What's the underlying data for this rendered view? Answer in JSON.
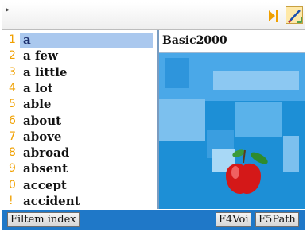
{
  "search": {
    "cursor_mark": "▸",
    "value": ""
  },
  "toolbar": {
    "speaker_icon": "speaker-play-icon",
    "pen_icon": "pen-edit-icon"
  },
  "words": [
    {
      "num": "1",
      "text": "a",
      "selected": true
    },
    {
      "num": "2",
      "text": "a few"
    },
    {
      "num": "3",
      "text": "a little"
    },
    {
      "num": "4",
      "text": "a lot"
    },
    {
      "num": "5",
      "text": "able"
    },
    {
      "num": "6",
      "text": "about"
    },
    {
      "num": "7",
      "text": "above"
    },
    {
      "num": "8",
      "text": "abroad"
    },
    {
      "num": "9",
      "text": "absent"
    },
    {
      "num": "0",
      "text": "accept"
    },
    {
      "num": "!",
      "text": "accident"
    }
  ],
  "preview": {
    "title": "Basic2000",
    "image": "apple-illustration"
  },
  "status": {
    "filter_label": "Filtem index",
    "f4_label": "F4Voi",
    "f5_label": "F5Path"
  },
  "colors": {
    "accent": "#f0a000",
    "selection": "#aac8ee",
    "statusbar": "#1f78c8",
    "preview_bg": "#1d8fd6"
  }
}
